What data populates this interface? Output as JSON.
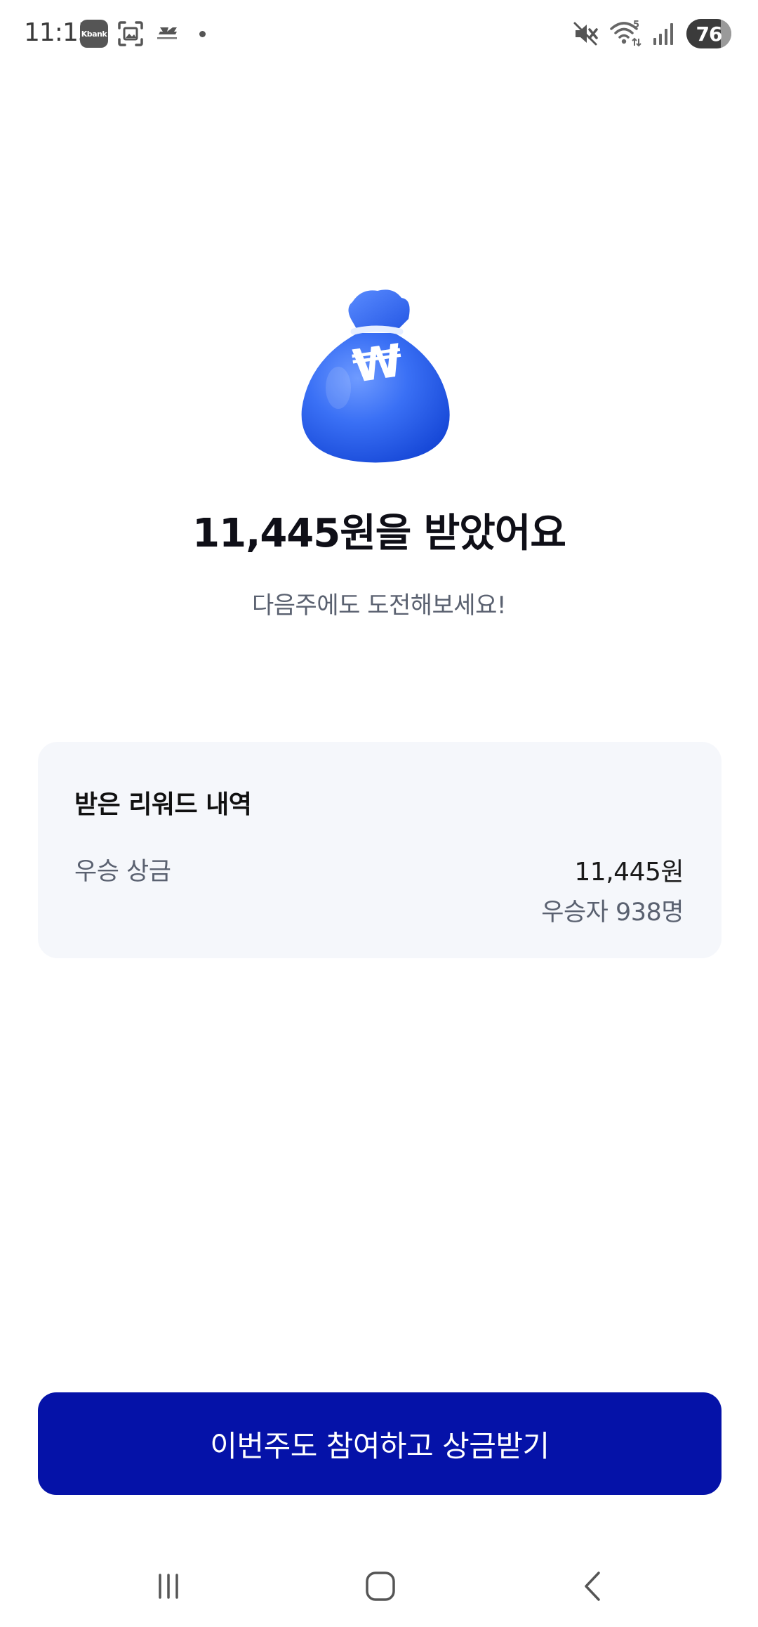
{
  "status_bar": {
    "time": "11:15",
    "kbank_label": "Kbank",
    "battery_level": 76,
    "battery_text": "76",
    "wifi_badge": "5",
    "icons": [
      "kbank-app-icon",
      "screenshot-icon",
      "new-balance-icon",
      "notification-dot",
      "mute-icon",
      "wifi-icon",
      "signal-icon",
      "battery-icon"
    ]
  },
  "hero": {
    "icon": "money-bag-icon",
    "currency_symbol": "₩",
    "title": "11,445원을 받았어요",
    "subtitle": "다음주에도 도전해보세요!"
  },
  "reward_card": {
    "title": "받은 리워드 내역",
    "label": "우승 상금",
    "amount": "11,445원",
    "winners": "우승자 938명"
  },
  "cta": {
    "label": "이번주도 참여하고 상금받기"
  },
  "nav_bar": {
    "icons": [
      "recent-apps-icon",
      "home-icon",
      "back-icon"
    ]
  },
  "colors": {
    "primary": "#0512a8",
    "bag_blue": "#2f67f0",
    "card_bg": "#f5f7fb",
    "subtext": "#5a6170"
  }
}
